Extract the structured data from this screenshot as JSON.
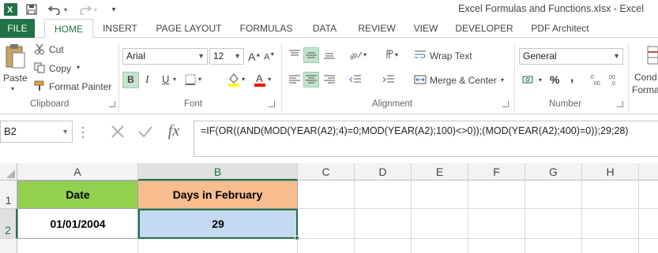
{
  "window": {
    "title": "Excel Formulas and Functions.xlsx - Excel"
  },
  "tabs": [
    "FILE",
    "HOME",
    "INSERT",
    "PAGE LAYOUT",
    "FORMULAS",
    "DATA",
    "REVIEW",
    "VIEW",
    "DEVELOPER",
    "PDF Architect"
  ],
  "ribbon": {
    "clipboard": {
      "label": "Clipboard",
      "paste": "Paste",
      "cut": "Cut",
      "copy": "Copy",
      "format_painter": "Format Painter"
    },
    "font": {
      "label": "Font",
      "font_name": "Arial",
      "font_size": "12",
      "bold": "B",
      "italic": "I",
      "underline": "U"
    },
    "alignment": {
      "label": "Alignment",
      "wrap_text": "Wrap Text",
      "merge_center": "Merge & Center"
    },
    "number": {
      "label": "Number",
      "format": "General",
      "percent": "%",
      "comma": ","
    },
    "styles": {
      "cond_line1": "Cond",
      "cond_line2": "Forma"
    }
  },
  "formula_bar": {
    "name_box": "B2",
    "formula": "=IF(OR((AND(MOD(YEAR(A2);4)=0;MOD(YEAR(A2);100)<>0));(MOD(YEAR(A2);400)=0));29;28)"
  },
  "sheet": {
    "columns": [
      "A",
      "B",
      "C",
      "D",
      "E",
      "F",
      "G",
      "H"
    ],
    "rows": [
      "1",
      "2"
    ],
    "cells": {
      "A1": "Date",
      "B1": "Days in February",
      "A2": "01/01/2004",
      "B2": "29"
    }
  },
  "colors": {
    "accent": "#217346",
    "header_a1": "#92d050",
    "header_b1": "#f8bd8f",
    "selected_b2": "#c5d9f1"
  }
}
